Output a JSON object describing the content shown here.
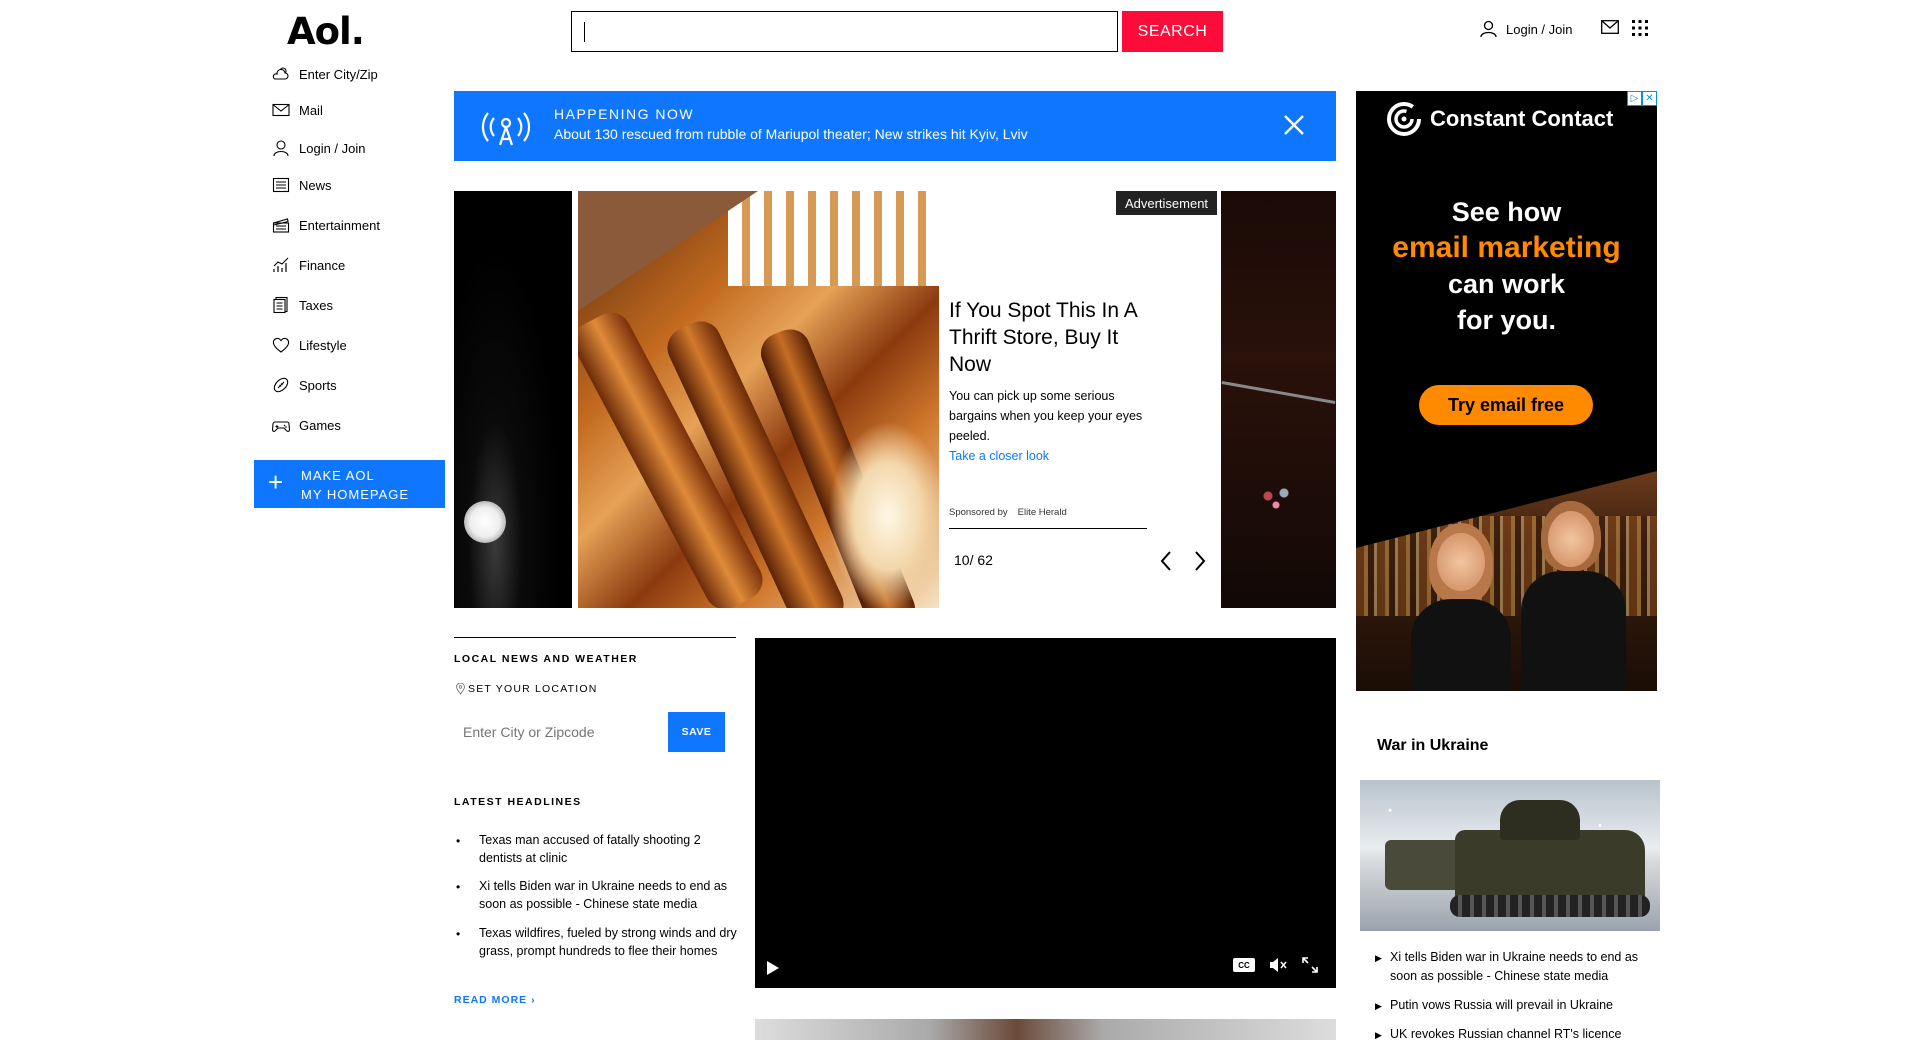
{
  "header": {
    "logo": "Aol.",
    "search_placeholder": "",
    "search_button": "SEARCH",
    "login_label": "Login / Join"
  },
  "sidebar": {
    "items": [
      {
        "label": "Enter City/Zip",
        "icon": "weather-icon"
      },
      {
        "label": "Mail",
        "icon": "mail-icon"
      },
      {
        "label": "Login / Join",
        "icon": "user-icon"
      },
      {
        "label": "News",
        "icon": "news-icon"
      },
      {
        "label": "Entertainment",
        "icon": "clapper-icon"
      },
      {
        "label": "Finance",
        "icon": "chart-icon"
      },
      {
        "label": "Taxes",
        "icon": "document-icon"
      },
      {
        "label": "Lifestyle",
        "icon": "heart-icon"
      },
      {
        "label": "Sports",
        "icon": "football-icon"
      },
      {
        "label": "Games",
        "icon": "gamepad-icon"
      }
    ],
    "make_homepage": {
      "plus": "+",
      "line1": "MAKE AOL",
      "line2": "MY HOMEPAGE"
    }
  },
  "happening_now": {
    "title": "HAPPENING NOW",
    "text": "About 130 rescued from rubble of Mariupol theater; New strikes hit Kyiv, Lviv"
  },
  "carousel": {
    "ad_badge": "Advertisement",
    "title": "If You Spot This In A Thrift Store, Buy It Now",
    "description": "You can pick up some serious bargains when you keep your eyes peeled.",
    "link": "Take a closer look",
    "sponsored_by_label": "Sponsored by",
    "sponsor": "Elite Herald",
    "counter": "10/ 62",
    "current": 10,
    "total": 62
  },
  "local_news": {
    "title": "LOCAL NEWS AND WEATHER",
    "set_location": "SET YOUR LOCATION",
    "input_placeholder": "Enter City or Zipcode",
    "save_button": "SAVE"
  },
  "latest_headlines": {
    "title": "LATEST HEADLINES",
    "items": [
      "Texas man accused of fatally shooting 2 dentists at clinic",
      "Xi tells Biden war in Ukraine needs to end as soon as possible - Chinese state media",
      "Texas wildfires, fueled by strong winds and dry grass, prompt hundreds to flee their homes"
    ],
    "read_more": "READ MORE ›"
  },
  "video": {
    "cc_label": "CC"
  },
  "right_ad": {
    "brand": "Constant Contact",
    "headline_1": "See how",
    "headline_2": "email marketing",
    "headline_3": "can work",
    "headline_4": "for you.",
    "cta": "Try email free",
    "accent_color": "#ff8a00"
  },
  "war_in_ukraine": {
    "title": "War in Ukraine",
    "items": [
      "Xi tells Biden war in Ukraine needs to end as soon as possible - Chinese state media",
      "Putin vows Russia will prevail in Ukraine",
      "UK revokes Russian channel RT's licence"
    ]
  },
  "colors": {
    "brand_blue": "#0f77ff",
    "search_red": "#ff0b3a"
  }
}
